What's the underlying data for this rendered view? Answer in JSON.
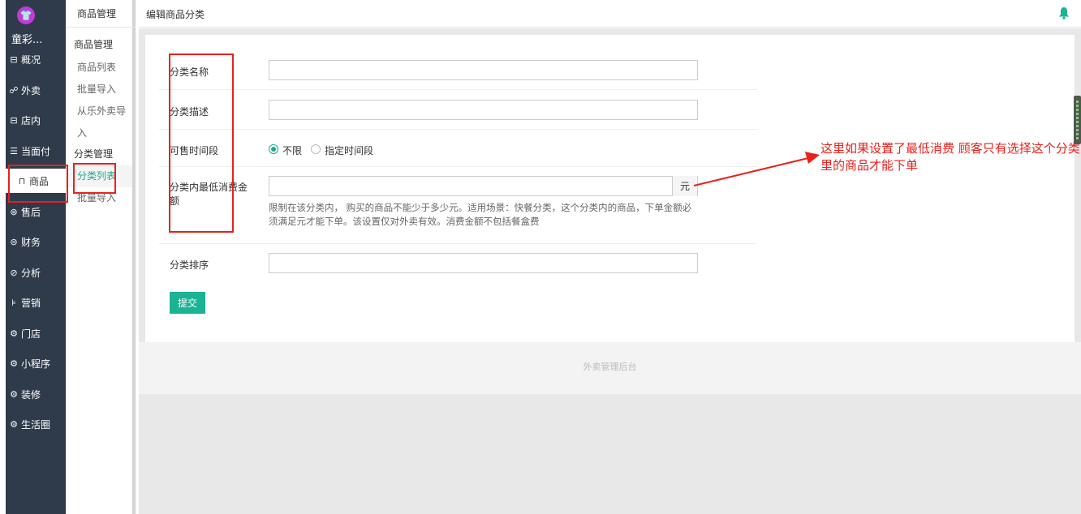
{
  "sidebar": {
    "shop_name": "童彩...",
    "logo_icon": "shirt-icon",
    "items": [
      {
        "label": "概况",
        "icon": "dashboard-icon"
      },
      {
        "label": "外卖",
        "icon": "bike-icon"
      },
      {
        "label": "店内",
        "icon": "store-icon"
      },
      {
        "label": "当面付",
        "icon": "receipt-icon"
      },
      {
        "label": "商品",
        "icon": "bag-icon"
      },
      {
        "label": "售后",
        "icon": "aftersale-icon"
      },
      {
        "label": "财务",
        "icon": "yuan-icon"
      },
      {
        "label": "分析",
        "icon": "chart-icon"
      },
      {
        "label": "营销",
        "icon": "flag-icon"
      },
      {
        "label": "门店",
        "icon": "gear-icon"
      },
      {
        "label": "小程序",
        "icon": "gear-icon"
      },
      {
        "label": "装修",
        "icon": "gear-icon"
      },
      {
        "label": "生活圈",
        "icon": "gear-icon"
      }
    ]
  },
  "sub_sidebar": {
    "header": "商品管理",
    "group1": "商品管理",
    "group1_items": [
      "商品列表",
      "批量导入",
      "从乐外卖导",
      "入"
    ],
    "group2": "分类管理",
    "group2_items": [
      "分类列表",
      "批量导入"
    ]
  },
  "topbar": {
    "title": "编辑商品分类"
  },
  "form": {
    "name_label": "分类名称",
    "desc_label": "分类描述",
    "time_label": "可售时间段",
    "time_opt1": "不限",
    "time_opt2": "指定时间段",
    "min_label_line1": "分类内最低消费金",
    "min_label_line2": "额",
    "unit": "元",
    "help_text": "限制在该分类内， 购买的商品不能少于多少元。适用场景：快餐分类，这个分类内的商品，下单金额必须满足元才能下单。该设置仅对外卖有效。消费金额不包括餐盒费",
    "sort_label": "分类排序",
    "submit": "提交"
  },
  "footer": "外卖管理后台",
  "annotation": "这里如果设置了最低消费  顾客只有选择这个分类里的商品才能下单",
  "colors": {
    "sidebar_bg": "#2f3b4a",
    "accent": "#1ab394",
    "annotation": "#e8211c",
    "logo": "#c13bd6"
  }
}
